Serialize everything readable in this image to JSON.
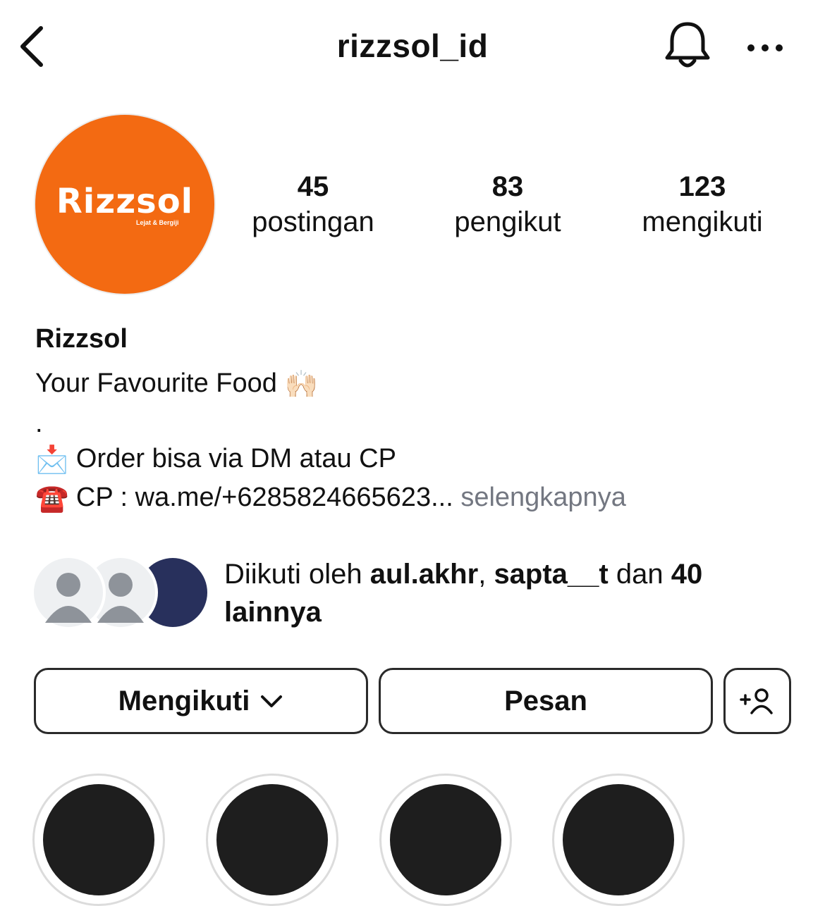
{
  "header": {
    "username": "rizzsol_id",
    "back_icon": "chevron-left-icon",
    "bell_icon": "bell-icon",
    "more_icon": "more-horizontal-icon"
  },
  "avatar": {
    "logo_text": "Rizzsol",
    "tagline": "Lejat & Bergiji",
    "background_color": "#f36a12"
  },
  "stats": [
    {
      "count": "45",
      "label": "postingan"
    },
    {
      "count": "83",
      "label": "pengikut"
    },
    {
      "count": "123",
      "label": "mengikuti"
    }
  ],
  "bio": {
    "name": "Rizzsol",
    "line1": "Your Favourite Food",
    "line1_emoji": "🙌🏻",
    "line2": ".",
    "line3_emoji": "📩",
    "line3": "Order bisa via DM atau CP",
    "line4_emoji": "☎️",
    "line4": "CP : wa.me/+6285824665623...",
    "more_link": "selengkapnya"
  },
  "followed_by": {
    "prefix": "Diikuti oleh",
    "user1": "aul.akhr",
    "sep": ",",
    "user2": "sapta__t",
    "middle": "dan",
    "count": "40",
    "suffix": "lainnya"
  },
  "buttons": {
    "follow_label": "Mengikuti",
    "message_label": "Pesan",
    "add_user_icon": "add-user-icon"
  },
  "colors": {
    "brand": "#f36a12",
    "muted_link": "#737781",
    "border": "#2a2a2a",
    "follower_avatar_navy": "#28305c"
  }
}
